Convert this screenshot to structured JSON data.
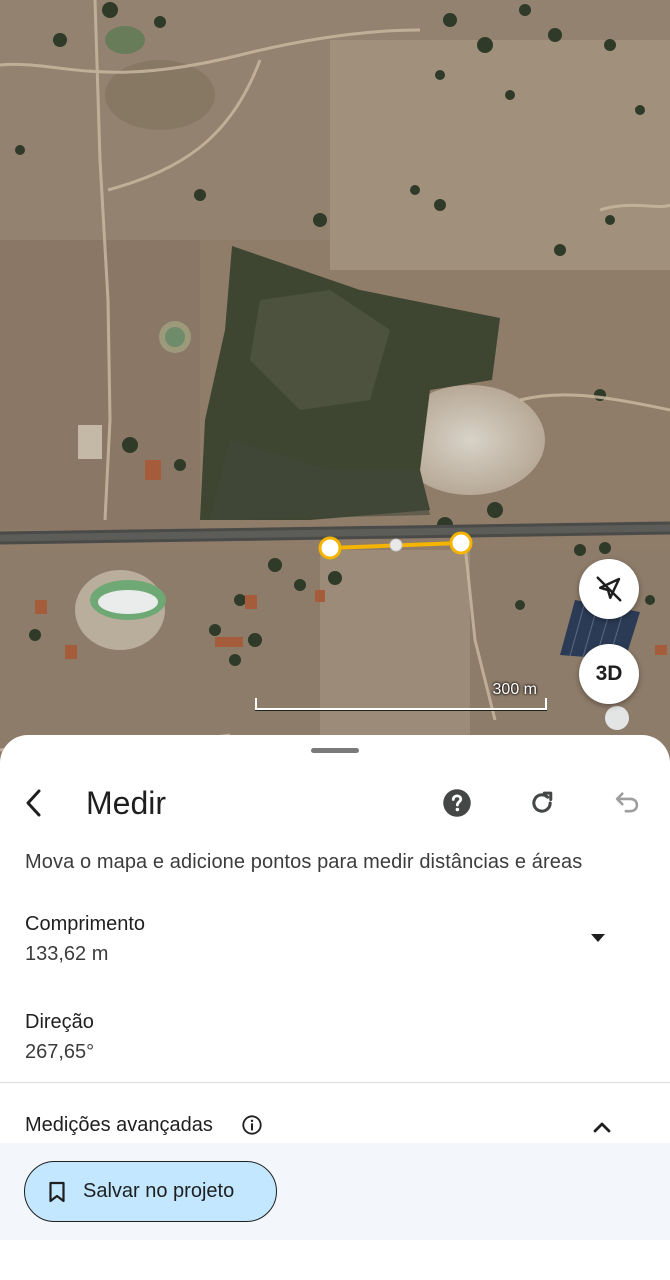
{
  "map": {
    "scale_label": "300 m",
    "btn_3d_label": "3D",
    "measure_line_color": "#f4b400"
  },
  "measure": {
    "title": "Medir",
    "instructions": "Mova o mapa e adicione pontos para medir distâncias e áreas",
    "length_label": "Comprimento",
    "length_value": "133,62 m",
    "direction_label": "Direção",
    "direction_value": "267,65°",
    "advanced_label": "Medições avançadas"
  },
  "actions": {
    "save_label": "Salvar no projeto"
  },
  "icons": {
    "back": "arrow-back-icon",
    "help": "help-circle-icon",
    "refresh": "refresh-icon",
    "undo": "undo-icon",
    "compass": "compass-off-icon",
    "expand": "chevron-down-icon",
    "collapse": "chevron-up-icon",
    "info": "info-icon",
    "bookmark": "bookmark-icon"
  },
  "colors": {
    "save_button_bg": "#c2e7ff",
    "footer_bg": "#f3f6fb"
  }
}
